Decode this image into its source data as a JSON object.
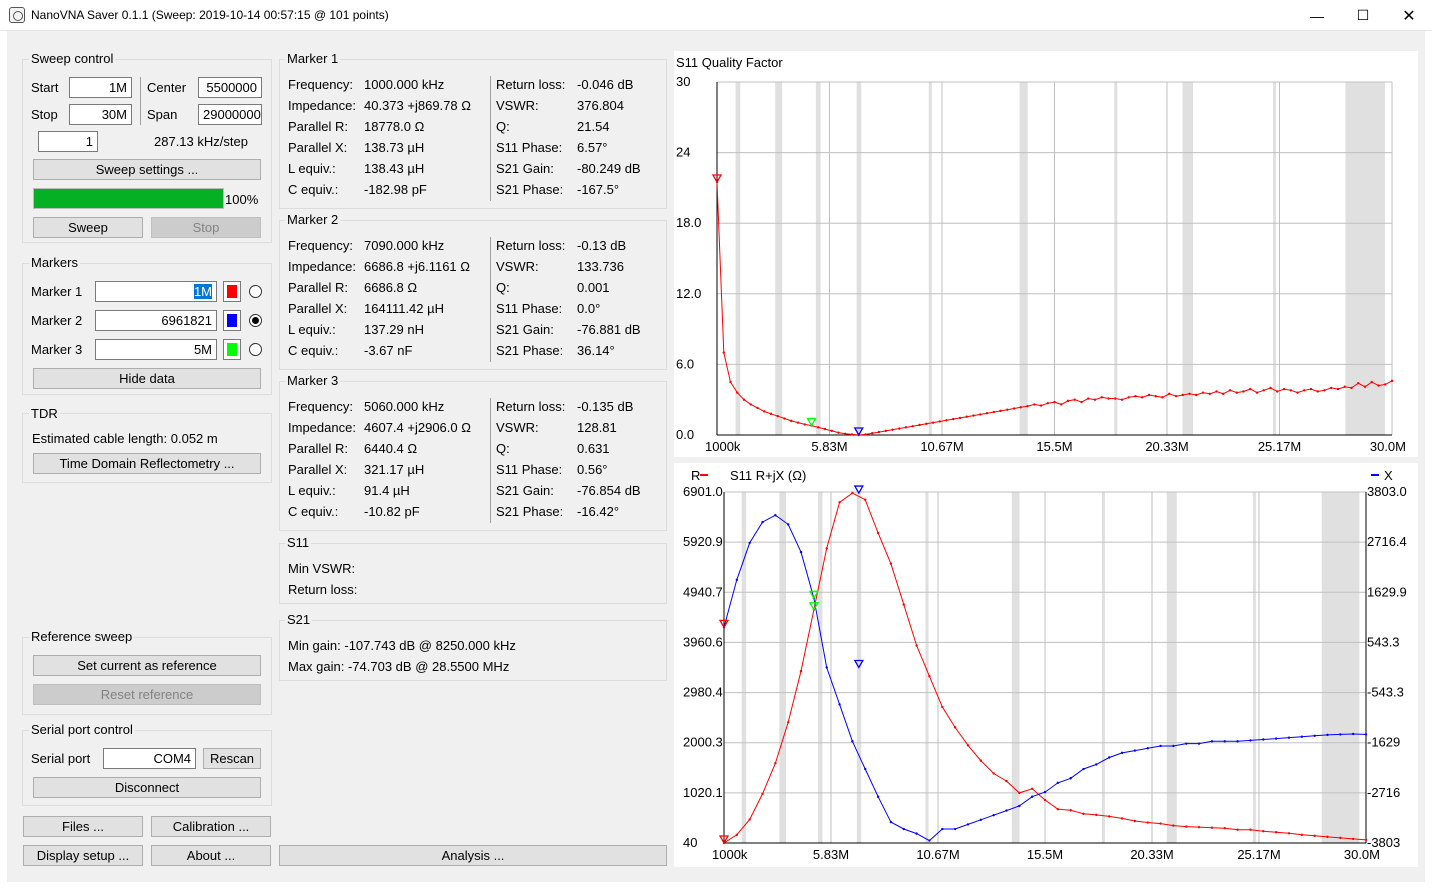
{
  "window": {
    "title": "NanoVNA Saver 0.1.1 (Sweep: 2019-10-14 00:57:15 @ 101 points)",
    "minimize": "—",
    "maximize": "☐",
    "close": "✕"
  },
  "sweep": {
    "title": "Sweep control",
    "start_label": "Start",
    "start_value": "1M",
    "center_label": "Center",
    "center_value": "5500000",
    "stop_label": "Stop",
    "stop_value": "30M",
    "span_label": "Span",
    "span_value": "29000000",
    "segments_value": "1",
    "step_text": "287.13 kHz/step",
    "settings_button": "Sweep settings ...",
    "progress_percent": 100,
    "progress_text": "100%",
    "sweep_button": "Sweep",
    "stop_button": "Stop"
  },
  "markers": {
    "title": "Markers",
    "items": [
      {
        "label": "Marker 1",
        "value": "1M",
        "color": "#ff0000",
        "selected": false
      },
      {
        "label": "Marker 2",
        "value": "6961821",
        "color": "#0000ff",
        "selected": true
      },
      {
        "label": "Marker 3",
        "value": "5M",
        "color": "#00ff00",
        "selected": false
      }
    ],
    "hide_button": "Hide data"
  },
  "tdr": {
    "title": "TDR",
    "estimate_text": "Estimated cable length: 0.052 m",
    "button": "Time Domain Reflectometry ..."
  },
  "reference": {
    "title": "Reference sweep",
    "set_button": "Set current as reference",
    "reset_button": "Reset reference"
  },
  "serial": {
    "title": "Serial port control",
    "port_label": "Serial port",
    "port_value": "COM4",
    "rescan_button": "Rescan",
    "disconnect_button": "Disconnect"
  },
  "bottom_buttons": {
    "files": "Files ...",
    "calibration": "Calibration ...",
    "display": "Display setup ...",
    "about": "About ...",
    "analysis": "Analysis ..."
  },
  "marker_data": [
    {
      "title": "Marker 1",
      "left": [
        [
          "Frequency:",
          "1000.000 kHz"
        ],
        [
          "Impedance:",
          "40.373 +j869.78 Ω"
        ],
        [
          "Parallel R:",
          "18778.0 Ω"
        ],
        [
          "Parallel X:",
          "138.73 µH"
        ],
        [
          "L equiv.:",
          "138.43 µH"
        ],
        [
          "C equiv.:",
          "-182.98 pF"
        ]
      ],
      "right": [
        [
          "Return loss:",
          "-0.046 dB"
        ],
        [
          "VSWR:",
          "376.804"
        ],
        [
          "Q:",
          "21.54"
        ],
        [
          "S11 Phase:",
          "6.57°"
        ],
        [
          "S21 Gain:",
          "-80.249 dB"
        ],
        [
          "S21 Phase:",
          "-167.5°"
        ]
      ]
    },
    {
      "title": "Marker 2",
      "left": [
        [
          "Frequency:",
          "7090.000 kHz"
        ],
        [
          "Impedance:",
          "6686.8 +j6.1161 Ω"
        ],
        [
          "Parallel R:",
          "6686.8 Ω"
        ],
        [
          "Parallel X:",
          "164111.42 µH"
        ],
        [
          "L equiv.:",
          "137.29 nH"
        ],
        [
          "C equiv.:",
          "-3.67 nF"
        ]
      ],
      "right": [
        [
          "Return loss:",
          "-0.13 dB"
        ],
        [
          "VSWR:",
          "133.736"
        ],
        [
          "Q:",
          "0.001"
        ],
        [
          "S11 Phase:",
          "0.0°"
        ],
        [
          "S21 Gain:",
          "-76.881 dB"
        ],
        [
          "S21 Phase:",
          "36.14°"
        ]
      ]
    },
    {
      "title": "Marker 3",
      "left": [
        [
          "Frequency:",
          "5060.000 kHz"
        ],
        [
          "Impedance:",
          "4607.4 +j2906.0 Ω"
        ],
        [
          "Parallel R:",
          "6440.4 Ω"
        ],
        [
          "Parallel X:",
          "321.17 µH"
        ],
        [
          "L equiv.:",
          "91.4 µH"
        ],
        [
          "C equiv.:",
          "-10.82 pF"
        ]
      ],
      "right": [
        [
          "Return loss:",
          "-0.135 dB"
        ],
        [
          "VSWR:",
          "128.81"
        ],
        [
          "Q:",
          "0.631"
        ],
        [
          "S11 Phase:",
          "0.56°"
        ],
        [
          "S21 Gain:",
          "-76.854 dB"
        ],
        [
          "S21 Phase:",
          "-16.42°"
        ]
      ]
    }
  ],
  "s11_summary": {
    "title": "S11",
    "rows": [
      "Min VSWR:",
      "Return loss:"
    ]
  },
  "s21_summary": {
    "title": "S21",
    "rows": [
      "Min gain: -107.743 dB @ 8250.000 kHz",
      "Max gain: -74.703 dB @ 28.5500 MHz"
    ]
  },
  "chart_data": [
    {
      "type": "line",
      "title": "S11 Quality Factor",
      "ylim": [
        0,
        30
      ],
      "y_ticks": [
        "30",
        "24",
        "18.0",
        "12.0",
        "6.0",
        "0.0"
      ],
      "x_ticks": [
        "1000k",
        "5.83M",
        "10.67M",
        "15.5M",
        "20.33M",
        "25.17M",
        "30.0M"
      ],
      "xlim_mhz": [
        1.0,
        30.0
      ],
      "series": [
        {
          "color": "#ff0000",
          "x": [
            1.0,
            1.29,
            1.58,
            1.87,
            2.16,
            2.45,
            2.74,
            3.03,
            3.32,
            3.61,
            3.9,
            4.19,
            4.48,
            4.77,
            5.06,
            5.35,
            5.64,
            5.93,
            6.22,
            6.51,
            6.8,
            7.09,
            7.38,
            7.67,
            7.96,
            8.25,
            8.54,
            8.83,
            9.12,
            9.41,
            9.7,
            9.99,
            10.28,
            10.57,
            10.86,
            11.15,
            11.44,
            11.73,
            12.02,
            12.31,
            12.6,
            12.89,
            13.18,
            13.47,
            13.76,
            14.05,
            14.34,
            14.63,
            14.92,
            15.21,
            15.5,
            15.79,
            16.08,
            16.37,
            16.66,
            16.95,
            17.24,
            17.53,
            17.82,
            18.11,
            18.4,
            18.69,
            18.98,
            19.27,
            19.56,
            19.85,
            20.14,
            20.43,
            20.72,
            21.01,
            21.3,
            21.59,
            21.88,
            22.17,
            22.46,
            22.75,
            23.04,
            23.33,
            23.62,
            23.91,
            24.2,
            24.49,
            24.78,
            25.07,
            25.36,
            25.65,
            25.94,
            26.23,
            26.52,
            26.81,
            27.1,
            27.39,
            27.68,
            27.97,
            28.26,
            28.55,
            28.84,
            29.13,
            29.42,
            29.71,
            30.0
          ],
          "y": [
            21.5,
            7.0,
            4.5,
            3.6,
            3.0,
            2.6,
            2.3,
            2.0,
            1.8,
            1.6,
            1.4,
            1.2,
            1.05,
            0.9,
            0.8,
            0.65,
            0.5,
            0.35,
            0.2,
            0.1,
            0.05,
            0.0,
            0.05,
            0.15,
            0.25,
            0.35,
            0.45,
            0.55,
            0.65,
            0.75,
            0.85,
            0.95,
            1.05,
            1.15,
            1.25,
            1.35,
            1.45,
            1.55,
            1.65,
            1.75,
            1.85,
            1.95,
            2.05,
            2.15,
            2.25,
            2.35,
            2.45,
            2.6,
            2.5,
            2.7,
            2.8,
            2.6,
            2.9,
            3.0,
            2.8,
            3.1,
            3.0,
            3.2,
            3.1,
            3.1,
            3.0,
            3.2,
            3.3,
            3.2,
            3.4,
            3.3,
            3.2,
            3.5,
            3.3,
            3.4,
            3.5,
            3.4,
            3.6,
            3.5,
            3.7,
            3.5,
            3.8,
            3.6,
            3.7,
            3.9,
            3.6,
            3.8,
            4.0,
            3.7,
            3.9,
            3.8,
            3.6,
            3.8,
            3.9,
            3.7,
            3.8,
            4.0,
            3.9,
            4.1,
            4.0,
            4.4,
            4.1,
            4.5,
            4.2,
            4.3,
            4.6
          ]
        }
      ],
      "markers": [
        {
          "x": 1.0,
          "y": 21.5,
          "color": "#ff0000"
        },
        {
          "x": 5.06,
          "y": 0.8,
          "color": "#00ff00"
        },
        {
          "x": 7.09,
          "y": 0.0,
          "color": "#0000ff"
        }
      ]
    },
    {
      "type": "line",
      "title": "S11 R+jX (Ω)",
      "left_legend": "R",
      "right_legend": "X",
      "y_left_ticks": [
        "6901.0",
        "5920.9",
        "4940.7",
        "3960.6",
        "2980.4",
        "2000.3",
        "1020.1",
        "40"
      ],
      "y_right_ticks": [
        "3803.0",
        "2716.4",
        "1629.9",
        "543.3",
        "-543.3",
        "-1629",
        "-2716",
        "-3803"
      ],
      "ylim_r": [
        40,
        6901
      ],
      "ylim_x": [
        -3803,
        3803
      ],
      "x_ticks": [
        "1000k",
        "5.83M",
        "10.67M",
        "15.5M",
        "20.33M",
        "25.17M",
        "30.0M"
      ],
      "xlim_mhz": [
        1.0,
        30.0
      ],
      "series": [
        {
          "name": "R",
          "color": "#ff0000",
          "x": [
            1.0,
            1.58,
            2.16,
            2.74,
            3.32,
            3.9,
            4.48,
            5.06,
            5.64,
            6.22,
            6.8,
            7.38,
            7.96,
            8.54,
            9.12,
            9.7,
            10.28,
            10.86,
            11.44,
            12.02,
            12.6,
            13.18,
            13.76,
            14.34,
            14.92,
            15.5,
            16.08,
            16.66,
            17.24,
            17.82,
            18.4,
            18.98,
            19.56,
            20.14,
            20.72,
            21.3,
            21.88,
            22.46,
            23.04,
            23.62,
            24.2,
            24.78,
            25.36,
            25.94,
            26.52,
            27.1,
            27.68,
            28.26,
            28.84,
            29.42,
            30.0
          ],
          "y": [
            40,
            200,
            500,
            1000,
            1600,
            2400,
            3400,
            4600,
            5800,
            6700,
            6880,
            6750,
            6100,
            5500,
            4700,
            3900,
            3300,
            2700,
            2300,
            1950,
            1650,
            1400,
            1250,
            1020,
            1100,
            880,
            700,
            680,
            610,
            590,
            560,
            520,
            470,
            440,
            420,
            380,
            360,
            350,
            340,
            330,
            300,
            300,
            270,
            250,
            230,
            200,
            180,
            160,
            140,
            120,
            100
          ]
        },
        {
          "name": "X",
          "color": "#0000ff",
          "x": [
            1.0,
            1.58,
            2.16,
            2.74,
            3.32,
            3.9,
            4.48,
            5.06,
            5.64,
            6.22,
            6.8,
            7.38,
            7.96,
            8.54,
            9.12,
            9.7,
            10.28,
            10.86,
            11.44,
            12.02,
            12.6,
            13.18,
            13.76,
            14.34,
            14.92,
            15.5,
            16.08,
            16.66,
            17.24,
            17.82,
            18.4,
            18.98,
            19.56,
            20.14,
            20.72,
            21.3,
            21.88,
            22.46,
            23.04,
            23.62,
            24.2,
            24.78,
            25.36,
            25.94,
            26.52,
            27.1,
            27.68,
            28.26,
            28.84,
            29.42,
            30.0
          ],
          "y": [
            870,
            1900,
            2700,
            3150,
            3300,
            3100,
            2500,
            1500,
            0,
            -800,
            -1600,
            -2200,
            -2800,
            -3350,
            -3500,
            -3600,
            -3750,
            -3500,
            -3500,
            -3400,
            -3300,
            -3200,
            -3100,
            -3000,
            -2800,
            -2700,
            -2500,
            -2400,
            -2200,
            -2100,
            -1950,
            -1850,
            -1800,
            -1750,
            -1700,
            -1700,
            -1650,
            -1650,
            -1600,
            -1600,
            -1600,
            -1580,
            -1560,
            -1540,
            -1520,
            -1500,
            -1480,
            -1460,
            -1450,
            -1440,
            -1450
          ]
        }
      ],
      "markers": [
        {
          "series": "R",
          "x": 1.0,
          "y": 40,
          "color": "#ff0000"
        },
        {
          "series": "X",
          "x": 1.0,
          "y": 870,
          "color": "#ff0000"
        },
        {
          "series": "R",
          "x": 5.06,
          "y": 4600,
          "color": "#00ff00"
        },
        {
          "series": "X",
          "x": 5.06,
          "y": 1500,
          "color": "#00ff00"
        },
        {
          "series": "R",
          "x": 7.09,
          "y": 6880,
          "color": "#0000ff"
        },
        {
          "series": "X",
          "x": 7.09,
          "y": 0,
          "color": "#0000ff"
        }
      ]
    }
  ]
}
